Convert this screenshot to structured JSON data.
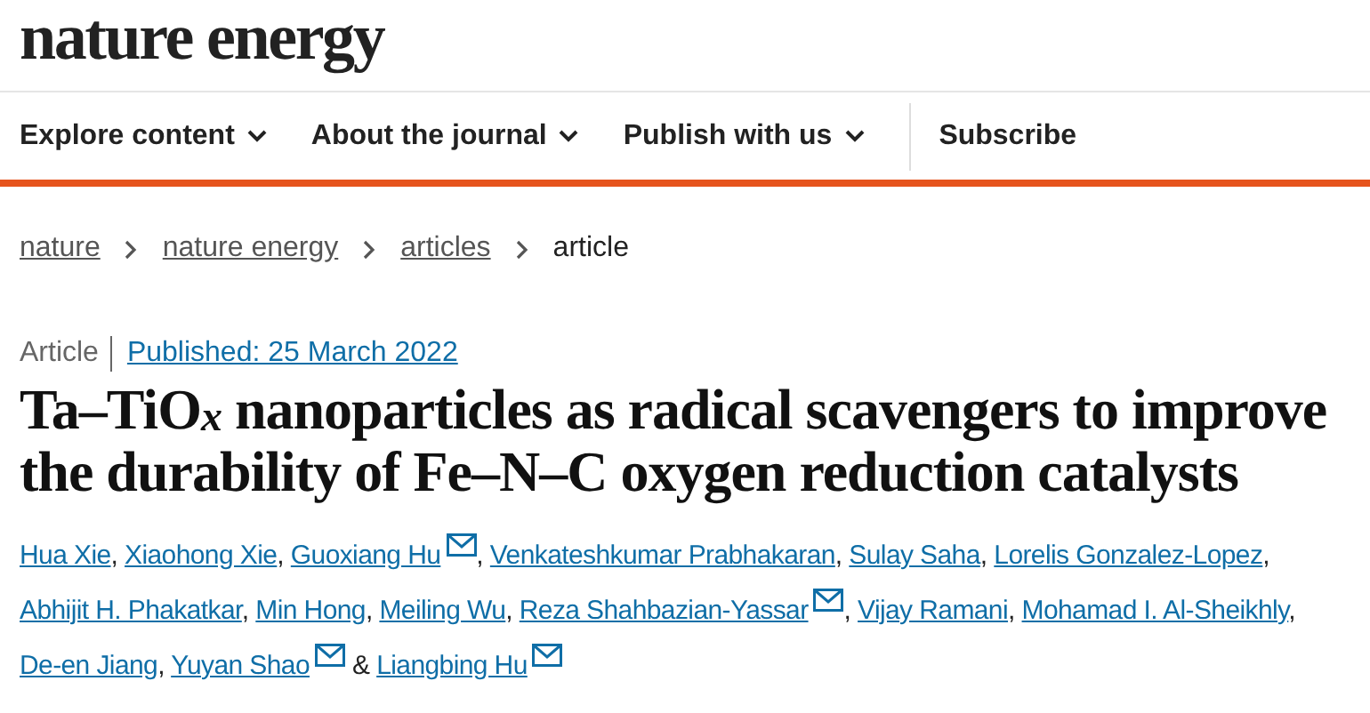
{
  "logo": "nature energy",
  "nav": [
    {
      "label": "Explore content",
      "kind": "menu"
    },
    {
      "label": "About the journal",
      "kind": "menu"
    },
    {
      "label": "Publish with us",
      "kind": "menu"
    },
    {
      "label": "Subscribe",
      "kind": "link"
    }
  ],
  "breadcrumbs": [
    {
      "label": "nature",
      "kind": "link"
    },
    {
      "label": "nature energy",
      "kind": "link"
    },
    {
      "label": "articles",
      "kind": "link"
    },
    {
      "label": "article",
      "kind": "current"
    }
  ],
  "article_type": "Article",
  "published": "Published: 25 March 2022",
  "title": "Ta–TiO$_{x}$ nanoparticles as radical scavengers to improve the durability of Fe–N–C oxygen reduction catalysts",
  "authors": [
    {
      "name": "Hua Xie",
      "email": false,
      "separator": ","
    },
    {
      "name": "Xiaohong Xie",
      "email": false,
      "separator": ","
    },
    {
      "name": "Guoxiang Hu",
      "email": true,
      "separator": ","
    },
    {
      "name": "Venkateshkumar Prabhakaran",
      "email": false,
      "separator": ","
    },
    {
      "name": "Sulay Saha",
      "email": false,
      "separator": ","
    },
    {
      "name": "Lorelis Gonzalez-Lopez",
      "email": false,
      "separator": ","
    },
    {
      "name": "Abhijit H. Phakatkar",
      "email": false,
      "separator": ","
    },
    {
      "name": "Min Hong",
      "email": false,
      "separator": ","
    },
    {
      "name": "Meiling Wu",
      "email": false,
      "separator": ","
    },
    {
      "name": "Reza Shahbazian-Yassar",
      "email": true,
      "separator": ","
    },
    {
      "name": "Vijay Ramani",
      "email": false,
      "separator": ","
    },
    {
      "name": "Mohamad I. Al-Sheikhly",
      "email": false,
      "separator": ","
    },
    {
      "name": "De-en Jiang",
      "email": false,
      "separator": ","
    },
    {
      "name": "Yuyan Shao",
      "email": true,
      "separator": "&"
    },
    {
      "name": "Liangbing Hu",
      "email": true
    }
  ]
}
